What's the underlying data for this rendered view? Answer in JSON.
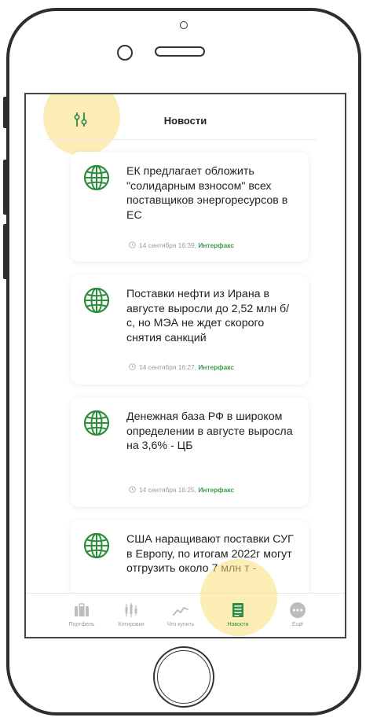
{
  "screen": {
    "title": "Новости",
    "news": [
      {
        "headline": "ЕК предлагает обложить \"солидарным взносом\" всех поставщиков энергоресурсов в ЕС",
        "time": "14 сентября 16:39",
        "source": "Интерфакс"
      },
      {
        "headline": "Поставки нефти из Ирана в августе выросли до 2,52 млн б/с, но МЭА не ждет скорого снятия санкций",
        "time": "14 сентября 16:27",
        "source": "Интерфакс"
      },
      {
        "headline": "Денежная база РФ в широком определении в августе выросла на 3,6% - ЦБ",
        "time": "14 сентября 16:25",
        "source": "Интерфакс"
      },
      {
        "headline": "США наращивают поставки СУГ в Европу, по итогам 2022г могут отгрузить около 7 млн т -",
        "time": "",
        "source": ""
      }
    ],
    "tabs": [
      {
        "label": "Портфель",
        "icon": "briefcase-icon",
        "active": false
      },
      {
        "label": "Котировки",
        "icon": "candlestick-icon",
        "active": false
      },
      {
        "label": "Что купить",
        "icon": "trend-icon",
        "active": false
      },
      {
        "label": "Новости",
        "icon": "newspaper-icon",
        "active": true
      },
      {
        "label": "Ещё",
        "icon": "more-icon",
        "active": false
      }
    ]
  },
  "colors": {
    "accent_green": "#2d8d3c",
    "source_green": "#3e9b4c",
    "highlight": "#fadc78",
    "frame": "#2e2e2e"
  }
}
